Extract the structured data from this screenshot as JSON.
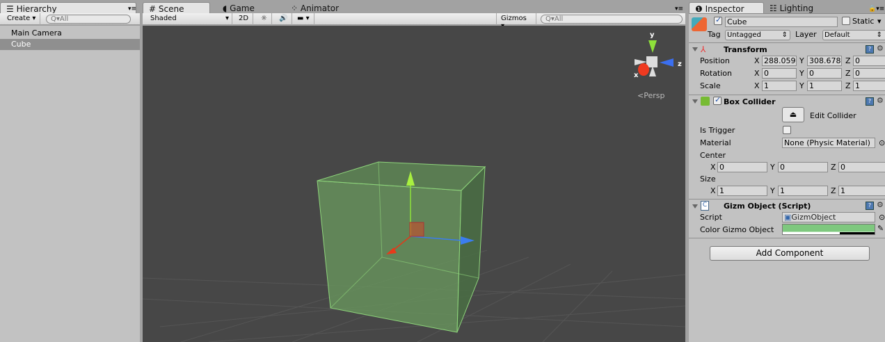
{
  "hierarchy": {
    "tab": "Hierarchy",
    "create": "Create",
    "search_placeholder": "All",
    "items": [
      "Main Camera",
      "Cube"
    ]
  },
  "scene": {
    "tabs": [
      "Scene",
      "Game",
      "Animator"
    ],
    "shading": "Shaded",
    "mode2d": "2D",
    "gizmos": "Gizmos",
    "search_placeholder": "All",
    "persp": "Persp",
    "axes": {
      "x": "x",
      "y": "y",
      "z": "z"
    }
  },
  "inspector": {
    "tabs": [
      "Inspector",
      "Lighting"
    ],
    "object_name": "Cube",
    "static_label": "Static",
    "tag_label": "Tag",
    "tag": "Untagged",
    "layer_label": "Layer",
    "layer": "Default",
    "transform": {
      "title": "Transform",
      "position": {
        "label": "Position",
        "x": "288.059",
        "y": "308.678",
        "z": "0"
      },
      "rotation": {
        "label": "Rotation",
        "x": "0",
        "y": "0",
        "z": "0"
      },
      "scale": {
        "label": "Scale",
        "x": "1",
        "y": "1",
        "z": "1"
      }
    },
    "box_collider": {
      "title": "Box Collider",
      "edit": "Edit Collider",
      "is_trigger": "Is Trigger",
      "material_label": "Material",
      "material": "None (Physic Material)",
      "center_label": "Center",
      "center": {
        "x": "0",
        "y": "0",
        "z": "0"
      },
      "size_label": "Size",
      "size": {
        "x": "1",
        "y": "1",
        "z": "1"
      }
    },
    "script": {
      "title": "Gizm Object (Script)",
      "script_label": "Script",
      "script": "GizmObject",
      "color_label": "Color Gizmo Object",
      "color": "#7ec87e"
    },
    "add_component": "Add Component"
  },
  "axis_labels": {
    "x": "X",
    "y": "Y",
    "z": "Z"
  }
}
